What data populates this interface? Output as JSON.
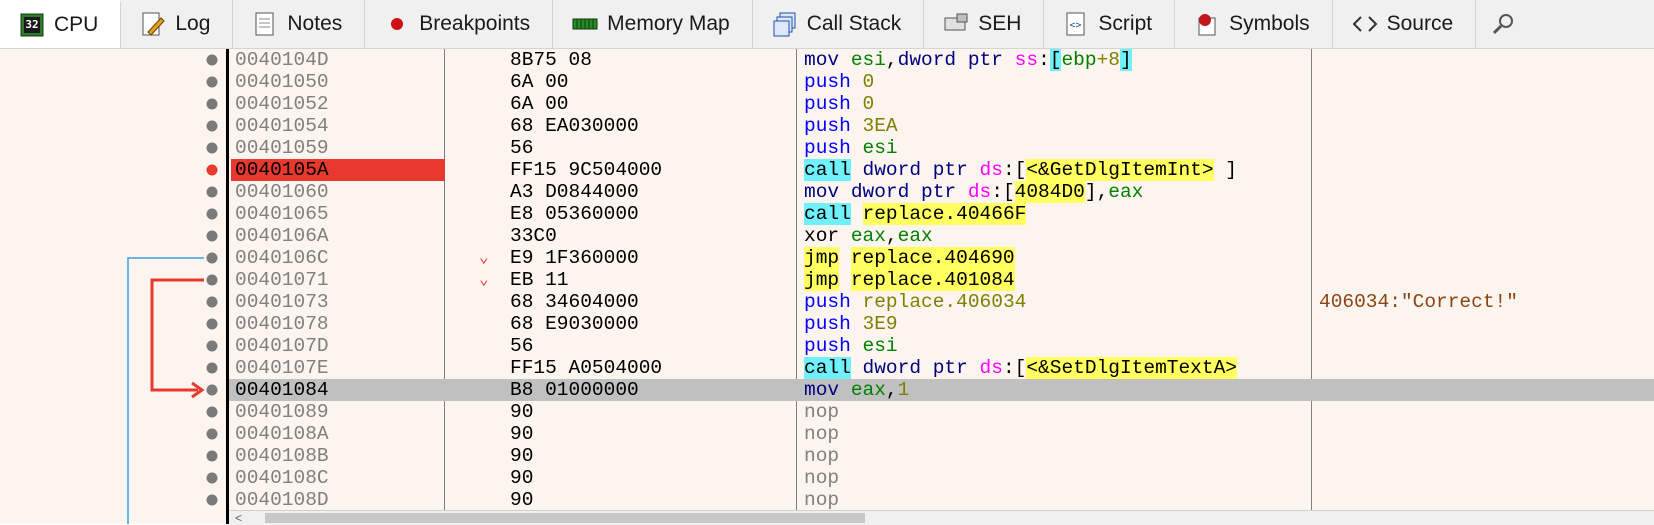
{
  "tabs": [
    {
      "label": "CPU",
      "icon": "cpu-chip-icon",
      "active": true
    },
    {
      "label": "Log",
      "icon": "log-pencil-icon"
    },
    {
      "label": "Notes",
      "icon": "notes-document-icon"
    },
    {
      "label": "Breakpoints",
      "icon": "breakpoint-dot-icon"
    },
    {
      "label": "Memory Map",
      "icon": "memory-map-icon"
    },
    {
      "label": "Call Stack",
      "icon": "call-stack-icon"
    },
    {
      "label": "SEH",
      "icon": "seh-icon"
    },
    {
      "label": "Script",
      "icon": "script-icon"
    },
    {
      "label": "Symbols",
      "icon": "symbols-icon"
    },
    {
      "label": "Source",
      "icon": "source-code-icon"
    },
    {
      "label": "",
      "icon": "search-icon"
    }
  ],
  "cpu_icon_text": "32",
  "colors": {
    "breakpoint": "#e8392f",
    "current_row": "#c0c0c0",
    "call_highlight": "#70f0f8",
    "jump_highlight": "#ffff60",
    "jump_arrow": "#e8392f",
    "loop_line": "#3aa0e0"
  },
  "rows": [
    {
      "addr": "0040104D",
      "bytes": "8B75 08",
      "instr": [
        [
          "k-mov",
          "mov "
        ],
        [
          "t-reg",
          "esi"
        ],
        [
          "t-plain",
          ","
        ],
        [
          "t-ptr",
          "dword ptr "
        ],
        [
          "t-seg",
          "ss"
        ],
        [
          "t-plain",
          ":"
        ],
        [
          "t-brk",
          "["
        ],
        [
          "t-reg",
          "ebp"
        ],
        [
          "t-num",
          "+8"
        ],
        [
          "t-brk",
          "]"
        ]
      ]
    },
    {
      "addr": "00401050",
      "bytes": "6A 00",
      "instr": [
        [
          "k-push",
          "push "
        ],
        [
          "t-num",
          "0"
        ]
      ]
    },
    {
      "addr": "00401052",
      "bytes": "6A 00",
      "instr": [
        [
          "k-push",
          "push "
        ],
        [
          "t-num",
          "0"
        ]
      ]
    },
    {
      "addr": "00401054",
      "bytes": "68 EA030000",
      "instr": [
        [
          "k-push",
          "push "
        ],
        [
          "t-num",
          "3EA"
        ]
      ]
    },
    {
      "addr": "00401059",
      "bytes": "56",
      "instr": [
        [
          "k-push",
          "push "
        ],
        [
          "t-reg",
          "esi"
        ]
      ]
    },
    {
      "addr": "0040105A",
      "bytes": "FF15 9C504000",
      "breakpoint": true,
      "instr": [
        [
          "k-call",
          "call"
        ],
        [
          "t-plain",
          " "
        ],
        [
          "t-ptr",
          "dword ptr "
        ],
        [
          "t-seg",
          "ds"
        ],
        [
          "t-plain",
          ":["
        ],
        [
          "t-hl",
          "<&GetDlgItemInt>"
        ],
        [
          "t-plain",
          " ]"
        ]
      ]
    },
    {
      "addr": "00401060",
      "bytes": "A3 D0844000",
      "instr": [
        [
          "k-mov",
          "mov "
        ],
        [
          "t-ptr",
          "dword ptr "
        ],
        [
          "t-seg",
          "ds"
        ],
        [
          "t-plain",
          ":["
        ],
        [
          "t-hl",
          "4084D0"
        ],
        [
          "t-plain",
          "],"
        ],
        [
          "t-reg",
          "eax"
        ]
      ]
    },
    {
      "addr": "00401065",
      "bytes": "E8 05360000",
      "instr": [
        [
          "k-call",
          "call"
        ],
        [
          "t-plain",
          " "
        ],
        [
          "t-hl",
          "replace.40466F"
        ]
      ]
    },
    {
      "addr": "0040106A",
      "bytes": "33C0",
      "instr": [
        [
          "k-xor",
          "xor "
        ],
        [
          "t-reg",
          "eax"
        ],
        [
          "t-plain",
          ","
        ],
        [
          "t-reg",
          "eax"
        ]
      ]
    },
    {
      "addr": "0040106C",
      "bytes": "E9 1F360000",
      "jmark": "⌄",
      "instr": [
        [
          "k-jmp",
          "jmp"
        ],
        [
          "t-plain",
          " "
        ],
        [
          "t-hl",
          "replace.404690"
        ]
      ]
    },
    {
      "addr": "00401071",
      "bytes": "EB 11",
      "jmark": "⌄",
      "instr": [
        [
          "k-jmp",
          "jmp"
        ],
        [
          "t-plain",
          " "
        ],
        [
          "t-hl",
          "replace.401084"
        ]
      ]
    },
    {
      "addr": "00401073",
      "bytes": "68 34604000",
      "instr": [
        [
          "k-push",
          "push "
        ],
        [
          "t-num",
          "replace.406034"
        ]
      ],
      "comment": "406034:\"Correct!\""
    },
    {
      "addr": "00401078",
      "bytes": "68 E9030000",
      "instr": [
        [
          "k-push",
          "push "
        ],
        [
          "t-num",
          "3E9"
        ]
      ]
    },
    {
      "addr": "0040107D",
      "bytes": "56",
      "instr": [
        [
          "k-push",
          "push "
        ],
        [
          "t-reg",
          "esi"
        ]
      ]
    },
    {
      "addr": "0040107E",
      "bytes": "FF15 A0504000",
      "instr": [
        [
          "k-call",
          "call"
        ],
        [
          "t-plain",
          " "
        ],
        [
          "t-ptr",
          "dword ptr "
        ],
        [
          "t-seg",
          "ds"
        ],
        [
          "t-plain",
          ":["
        ],
        [
          "t-hl",
          "<&SetDlgItemTextA>"
        ]
      ]
    },
    {
      "addr": "00401084",
      "bytes": "B8 01000000",
      "current": true,
      "instr": [
        [
          "k-mov",
          "mov "
        ],
        [
          "t-reg",
          "eax"
        ],
        [
          "t-plain",
          ","
        ],
        [
          "t-num",
          "1"
        ]
      ]
    },
    {
      "addr": "00401089",
      "bytes": "90",
      "instr": [
        [
          "k-nop",
          "nop"
        ]
      ]
    },
    {
      "addr": "0040108A",
      "bytes": "90",
      "instr": [
        [
          "k-nop",
          "nop"
        ]
      ]
    },
    {
      "addr": "0040108B",
      "bytes": "90",
      "instr": [
        [
          "k-nop",
          "nop"
        ]
      ]
    },
    {
      "addr": "0040108C",
      "bytes": "90",
      "instr": [
        [
          "k-nop",
          "nop"
        ]
      ]
    },
    {
      "addr": "0040108D",
      "bytes": "90",
      "instr": [
        [
          "k-nop",
          "nop"
        ]
      ]
    }
  ],
  "scrollbar": {
    "arrow": "<"
  }
}
